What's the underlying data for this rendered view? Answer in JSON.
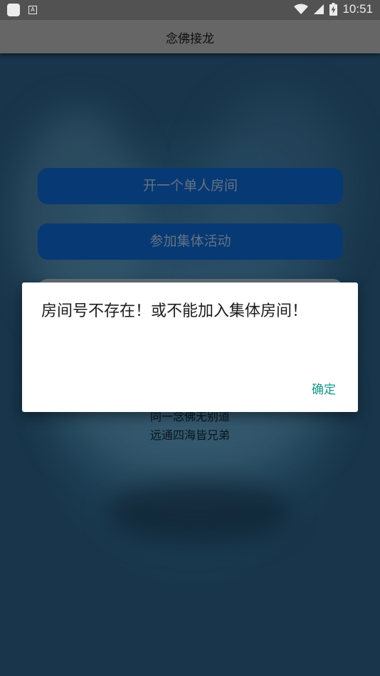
{
  "status_bar": {
    "a_label": "A",
    "time": "10:51",
    "icons": [
      "app-notification-icon",
      "a-notification-icon",
      "wifi-icon",
      "signal-icon",
      "battery-charging-icon"
    ]
  },
  "app_bar": {
    "title": "念佛接龙"
  },
  "main": {
    "buttons": [
      {
        "label": "开一个单人房间"
      },
      {
        "label": "参加集体活动"
      },
      {
        "label": ""
      }
    ],
    "quote_lines": [
      "同一念佛无别道",
      "远通四海皆兄弟"
    ]
  },
  "dialog": {
    "message": "房间号不存在！或不能加入集体房间！",
    "confirm_label": "确定"
  },
  "colors": {
    "accent": "#14968a",
    "button": "#083e7e",
    "background": "#1e3f58"
  }
}
